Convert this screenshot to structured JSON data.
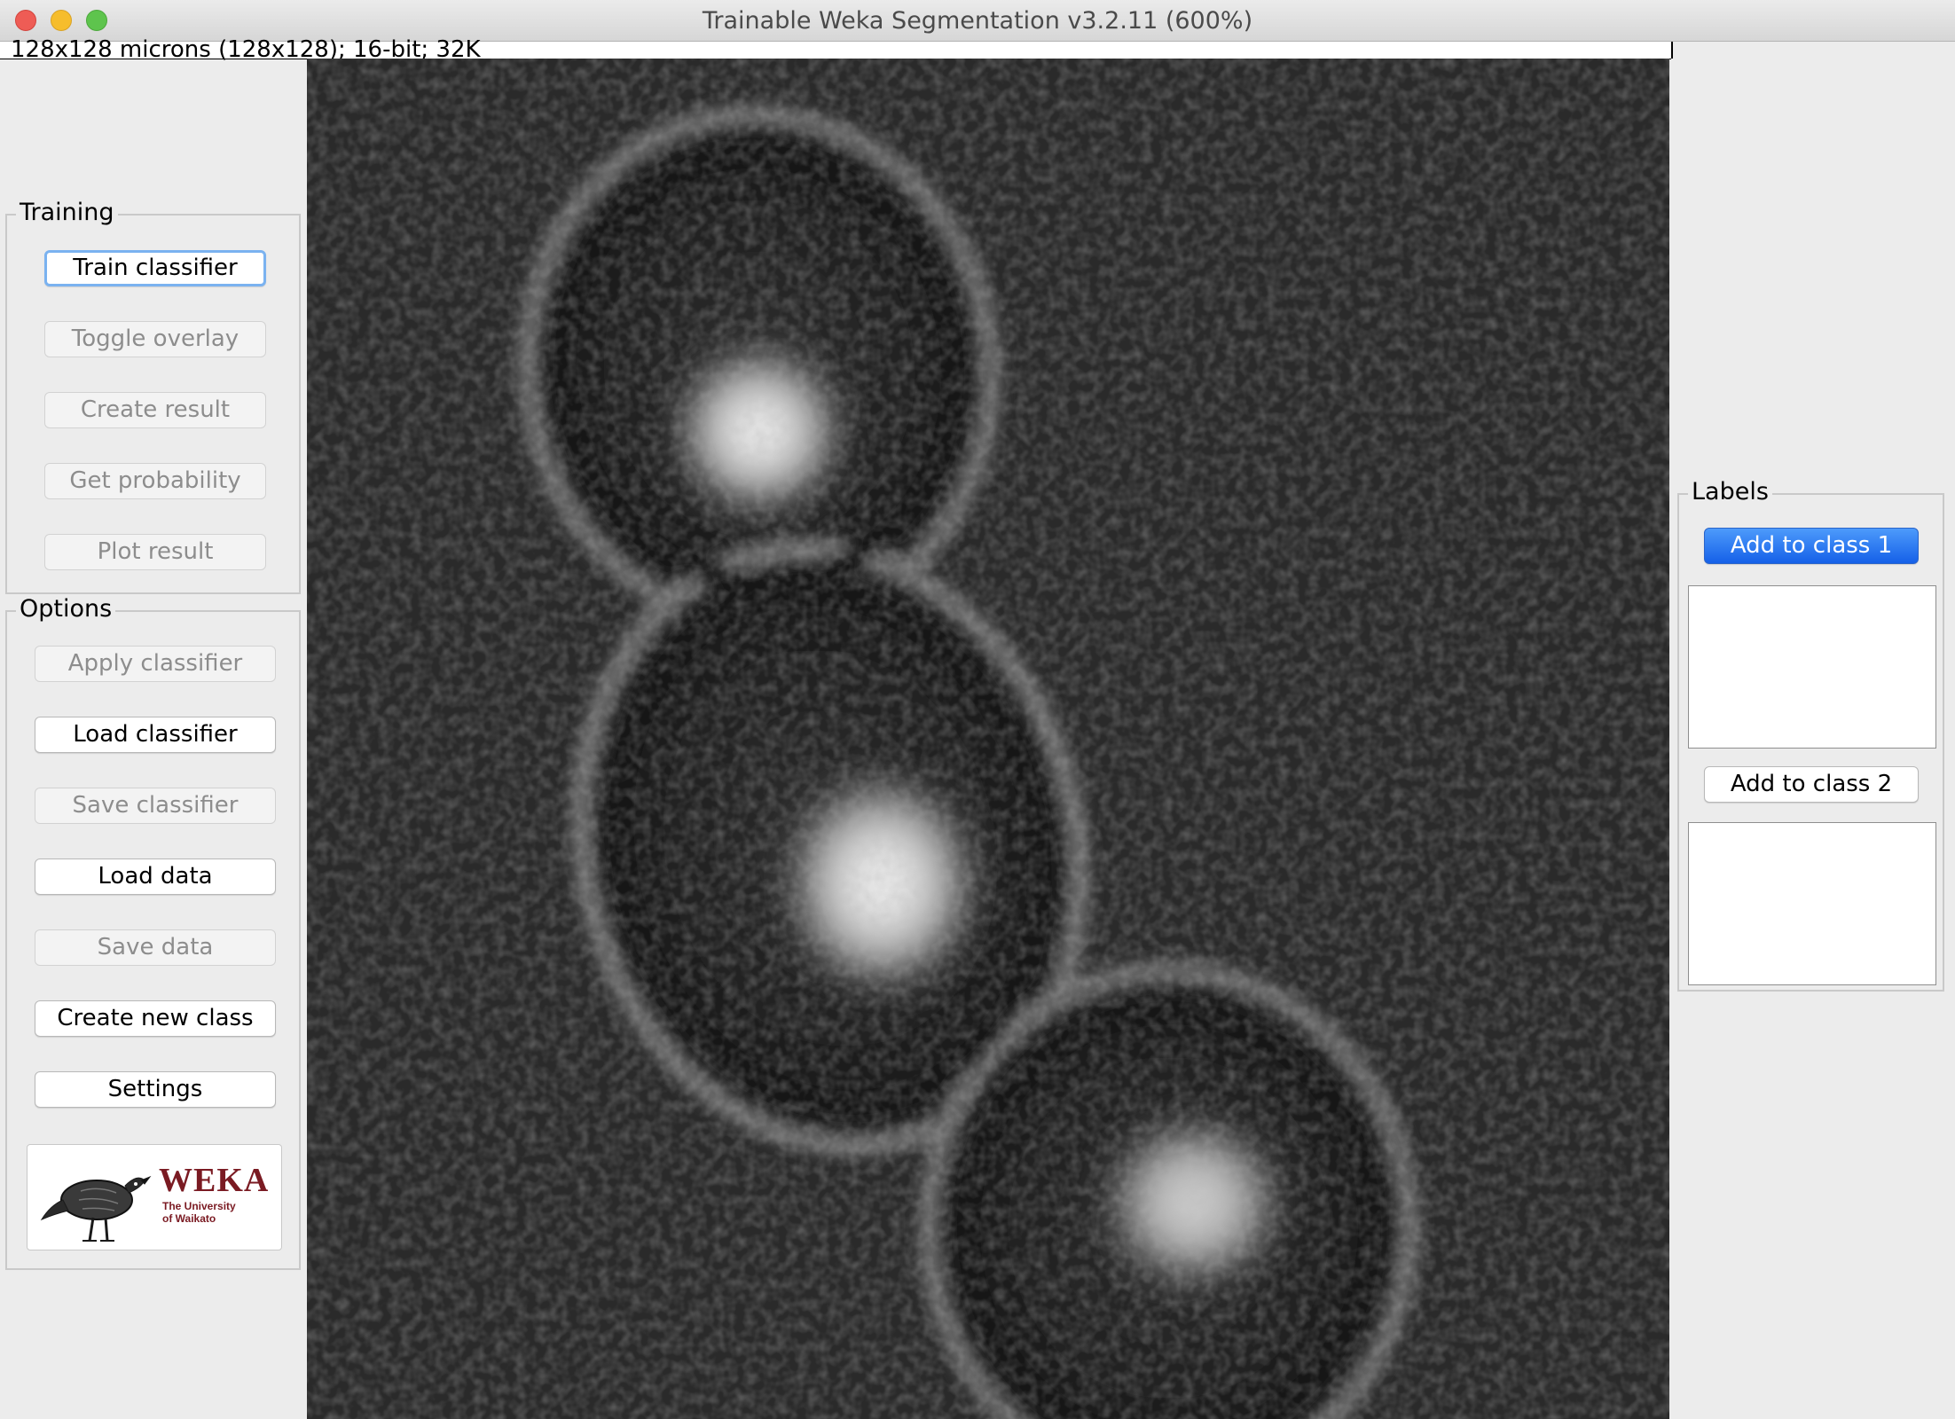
{
  "window": {
    "title": "Trainable Weka Segmentation v3.2.11 (600%)",
    "image_info": "128x128 microns (128x128); 16-bit; 32K"
  },
  "training": {
    "title": "Training",
    "buttons": [
      {
        "label": "Train classifier",
        "enabled": true
      },
      {
        "label": "Toggle overlay",
        "enabled": false
      },
      {
        "label": "Create result",
        "enabled": false
      },
      {
        "label": "Get probability",
        "enabled": false
      },
      {
        "label": "Plot result",
        "enabled": false
      }
    ]
  },
  "options": {
    "title": "Options",
    "buttons": [
      {
        "label": "Apply classifier",
        "enabled": false
      },
      {
        "label": "Load classifier",
        "enabled": true
      },
      {
        "label": "Save classifier",
        "enabled": false
      },
      {
        "label": "Load data",
        "enabled": true
      },
      {
        "label": "Save data",
        "enabled": false
      },
      {
        "label": "Create new class",
        "enabled": true
      },
      {
        "label": "Settings",
        "enabled": true
      }
    ]
  },
  "logo": {
    "text": "WEKA",
    "subtitle": "The University\nof Waikato"
  },
  "labels": {
    "title": "Labels",
    "classes": [
      {
        "label": "Add to class 1",
        "selected": true
      },
      {
        "label": "Add to class 2",
        "selected": false
      }
    ]
  },
  "colors": {
    "accent": "#1f6ff0",
    "logo": "#7a1a22"
  }
}
